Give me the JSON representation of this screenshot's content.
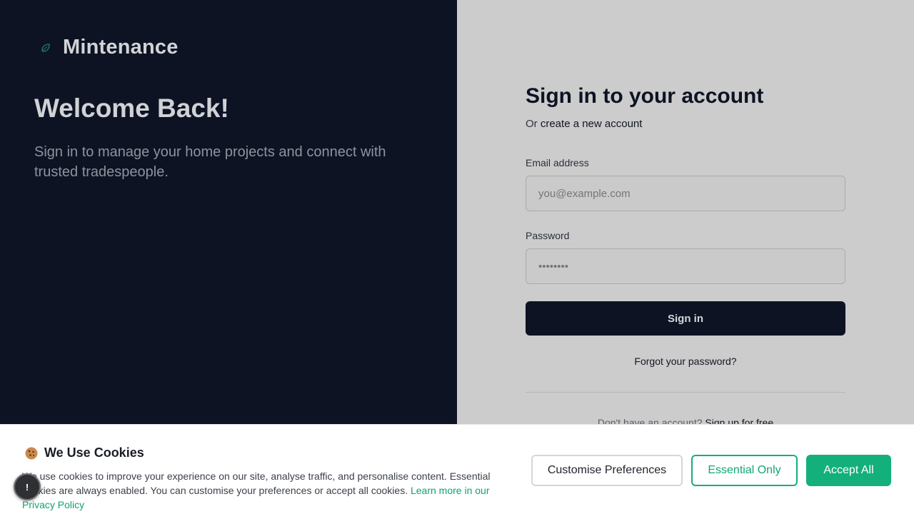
{
  "brand": {
    "name": "Mintenance",
    "icon": "leaf-logo-icon",
    "accent": "#13b07b"
  },
  "hero": {
    "title": "Welcome Back!",
    "tagline": "Sign in to manage your home projects and connect with trusted tradespeople."
  },
  "signin": {
    "title": "Sign in to your account",
    "or_prefix": "Or ",
    "create_link": "create a new account",
    "email_label": "Email address",
    "email_placeholder": "you@example.com",
    "password_label": "Password",
    "password_placeholder": "••••••••",
    "submit_label": "Sign in",
    "forgot_label": "Forgot your password?",
    "no_account_text": "Don't have an account? ",
    "signup_label": "Sign up for free"
  },
  "cookies": {
    "icon": "cookie-icon",
    "title": "We Use Cookies",
    "text": "We use cookies to improve your experience on our site, analyse traffic, and personalise content. Essential cookies are always enabled. You can customise your preferences or accept all cookies. ",
    "privacy_link": "Learn more in our Privacy Policy",
    "customise_label": "Customise Preferences",
    "essential_label": "Essential Only",
    "accept_label": "Accept All"
  },
  "fab": {
    "label": "!",
    "icon": "notification-icon"
  },
  "colors": {
    "dark_bg": "#0d1323",
    "right_bg": "#cccccc",
    "accent": "#13b07b"
  }
}
